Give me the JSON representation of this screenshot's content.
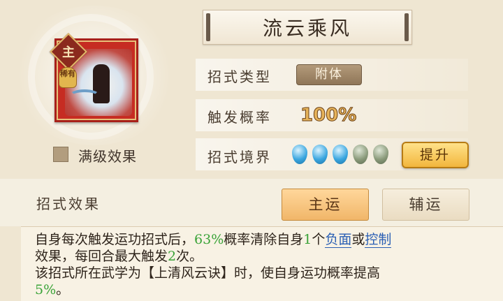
{
  "title": "流云乘风",
  "skill_card": {
    "main_badge": "主",
    "rare_badge": "稀有"
  },
  "max_level_label": "满级效果",
  "rows": {
    "type_label": "招式类型",
    "type_value": "附体",
    "prob_label": "触发概率",
    "prob_value": "100%",
    "realm_label": "招式境界",
    "realm_filled": 3,
    "realm_total": 5,
    "upgrade_label": "提升"
  },
  "effect": {
    "label": "招式效果",
    "tab_main": "主运",
    "tab_aux": "辅运",
    "line1_a": "自身每次触发运功招式后，",
    "line1_pct": "63%",
    "line1_b": "概率清除自身",
    "line1_num": "1",
    "line1_c": "个",
    "line1_link1": "负面",
    "line1_or": "或",
    "line1_link2": "控制",
    "line2_a": "效果，每回合最大触发",
    "line2_num": "2",
    "line2_b": "次。",
    "line3": "该招式所在武学为【上清风云诀】时，使自身运功概率提高",
    "line4_pct": "5%",
    "line4_end": "。"
  },
  "colors": {
    "highlight_green": "#3aa338",
    "link_blue": "#2a5fb4",
    "accent_gold": "#f2b63d",
    "card_red": "#c62c22"
  }
}
